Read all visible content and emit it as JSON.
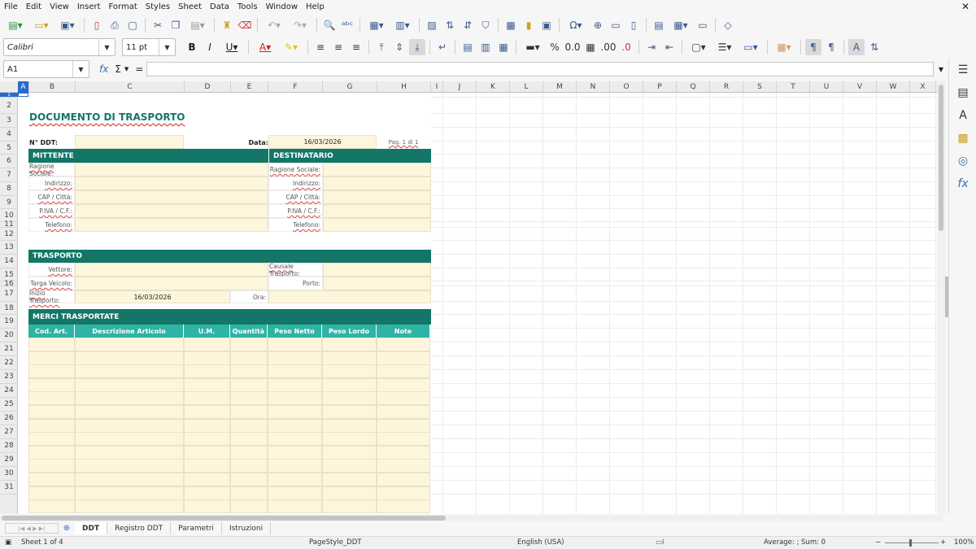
{
  "menu": [
    "File",
    "Edit",
    "View",
    "Insert",
    "Format",
    "Styles",
    "Sheet",
    "Data",
    "Tools",
    "Window",
    "Help"
  ],
  "font": {
    "name": "Calibri",
    "size": "11 pt"
  },
  "namebox": "A1",
  "formula_symbols": {
    "fx": "fx",
    "sum": "Σ",
    "eq": "="
  },
  "columns": [
    "A",
    "B",
    "C",
    "D",
    "E",
    "F",
    "G",
    "H",
    "I",
    "J",
    "K",
    "L",
    "M",
    "N",
    "O",
    "P",
    "Q",
    "R",
    "S",
    "T",
    "U",
    "V",
    "W",
    "X"
  ],
  "rows": [
    "1",
    "2",
    "3",
    "4",
    "5",
    "6",
    "7",
    "8",
    "9",
    "10",
    "11",
    "12",
    "13",
    "14",
    "15",
    "16",
    "17",
    "18",
    "19",
    "20",
    "21",
    "22",
    "23",
    "24",
    "25",
    "26",
    "27",
    "28",
    "29",
    "30",
    "31"
  ],
  "doc": {
    "title": "DOCUMENTO DI TRASPORTO",
    "nddt_label": "N° DDT:",
    "data_label": "Data:",
    "data_value": "16/03/2026",
    "pag": "Pag. 1 di 1",
    "mittente": "MITTENTE",
    "destinatario": "DESTINATARIO",
    "fields": [
      "Ragione Sociale:",
      "Indirizzo:",
      "CAP / Città:",
      "P.IVA / C.F.:",
      "Telefono:"
    ],
    "trasporto": "TRASPORTO",
    "vettore": "Vettore:",
    "causale": "Causale Trasporto:",
    "targa": "Targa Veicolo:",
    "porto": "Porto:",
    "inizio": "Inizio Trasporto:",
    "inizio_value": "16/03/2026",
    "ora": "Ora:",
    "merci": "MERCI TRASPORTATE",
    "cols": [
      "Cod. Art.",
      "Descrizione Articolo",
      "U.M.",
      "Quantità",
      "Peso Netto",
      "Peso Lordo",
      "Note"
    ]
  },
  "tabs": [
    "DDT",
    "Registro DDT",
    "Parametri",
    "Istruzioni"
  ],
  "status": {
    "sheet": "Sheet 1 of 4",
    "pagestyle": "PageStyle_DDT",
    "lang": "English (USA)",
    "sum": "Average: ; Sum: 0",
    "zoom": "100%"
  },
  "colors": {
    "band": "#137667",
    "subband": "#2fb3a5",
    "cell": "#fdf6dc"
  }
}
